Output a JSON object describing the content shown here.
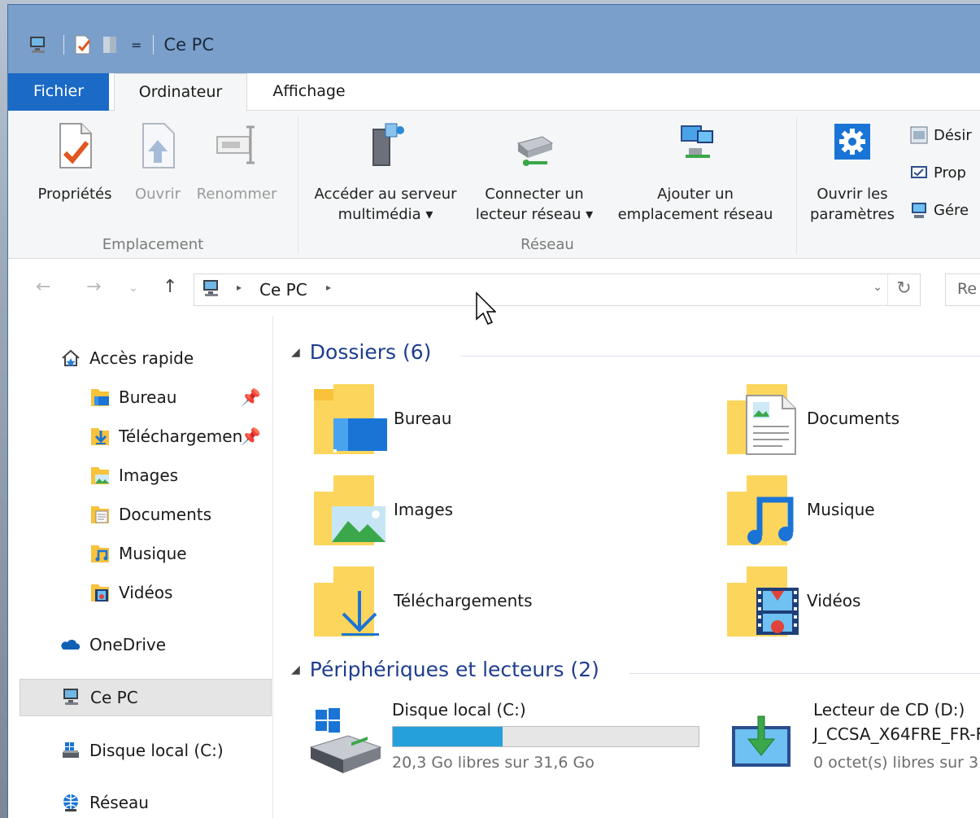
{
  "window": {
    "title": "Ce PC",
    "qat_dropdown": "="
  },
  "tabs": {
    "fichier": "Fichier",
    "ordinateur": "Ordinateur",
    "affichage": "Affichage"
  },
  "ribbon": {
    "emplacement": {
      "label": "Emplacement",
      "proprietes": "Propriétés",
      "ouvrir": "Ouvrir",
      "renommer": "Renommer"
    },
    "reseau": {
      "label": "Réseau",
      "acceder_line1": "Accéder au serveur",
      "acceder_line2": "multimédia ▾",
      "connecter_line1": "Connecter un",
      "connecter_line2": "lecteur réseau ▾",
      "ajouter_line1": "Ajouter un",
      "ajouter_line2": "emplacement réseau"
    },
    "systeme": {
      "ouvrir_line1": "Ouvrir les",
      "ouvrir_line2": "paramètres",
      "desinstaller": "Désir",
      "proprietes": "Prop",
      "gerer": "Gére"
    }
  },
  "address": {
    "path": "Ce PC",
    "search_placeholder": "Re",
    "dropdown": "⌄",
    "refresh": "↻"
  },
  "nav": {
    "quick_access": "Accès rapide",
    "items": [
      {
        "label": "Bureau",
        "pinned": true
      },
      {
        "label": "Téléchargemen",
        "pinned": true
      },
      {
        "label": "Images",
        "pinned": false
      },
      {
        "label": "Documents",
        "pinned": false
      },
      {
        "label": "Musique",
        "pinned": false
      },
      {
        "label": "Vidéos",
        "pinned": false
      }
    ],
    "onedrive": "OneDrive",
    "ce_pc": "Ce PC",
    "disque": "Disque local (C:)",
    "reseau": "Réseau"
  },
  "content": {
    "folders_header": "Dossiers (6)",
    "folders": [
      {
        "label": "Bureau",
        "icon": "desktop-icon"
      },
      {
        "label": "Documents",
        "icon": "document-icon"
      },
      {
        "label": "Images",
        "icon": "picture-icon"
      },
      {
        "label": "Musique",
        "icon": "music-note-icon"
      },
      {
        "label": "Téléchargements",
        "icon": "download-arrow-icon"
      },
      {
        "label": "Vidéos",
        "icon": "film-icon"
      }
    ],
    "devices_header": "Périphériques et lecteurs (2)",
    "drive_c": {
      "name": "Disque local (C:)",
      "free": "20,3 Go libres sur 31,6 Go",
      "used_fraction": 0.358
    },
    "drive_d": {
      "name": "Lecteur de CD (D:)",
      "volume": "J_CCSA_X64FRE_FR-F",
      "free": "0 octet(s) libres sur 3"
    }
  },
  "colors": {
    "accent": "#1b6ac6",
    "titlebar": "#7a9fcb",
    "folder": "#f8c23a",
    "progress": "#26a0da",
    "section_text": "#1e3e8e"
  }
}
